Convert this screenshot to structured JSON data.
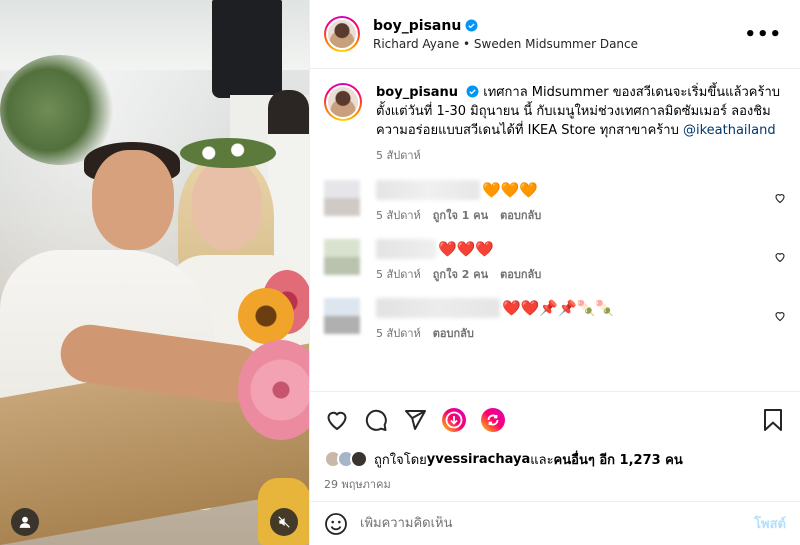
{
  "colors": {
    "link": "#00376b",
    "verified": "#0095f6",
    "muted": "#737373",
    "post_disabled": "#b2dffc"
  },
  "header": {
    "username": "boy_pisanu",
    "subline": "Richard Ayane • Sweden Midsummer Dance",
    "more_label": "•••"
  },
  "caption": {
    "username": "boy_pisanu",
    "text": " เทศกาล Midsummer ของสวีเดนจะเริ่มขึ้นแล้วคร้าบ ตั้งแต่วันที่ 1-30 มิถุนายน นี้ กับเมนูใหม่ช่วงเทศกาลมิดซัมเมอร์ ลองชิมความอร่อยแบบสวีเดนได้ที่ IKEA Store ทุกสาขาคร้าบ ",
    "mention": "@ikeathailand",
    "time": "5 สัปดาห์"
  },
  "comments": [
    {
      "emojis": "🧡🧡🧡",
      "time": "5 สัปดาห์",
      "likes": "ถูกใจ 1 คน",
      "reply": "ตอบกลับ"
    },
    {
      "emojis": "❤️❤️❤️",
      "time": "5 สัปดาห์",
      "likes": "ถูกใจ 2 คน",
      "reply": "ตอบกลับ"
    },
    {
      "emojis": "❤️❤️📌📌🍡🍡",
      "time": "5 สัปดาห์",
      "likes": "",
      "reply": "ตอบกลับ"
    }
  ],
  "likes": {
    "prefix": "ถูกใจโดย ",
    "user": "yvessirachaya",
    "middle": " และ",
    "others": "คนอื่นๆ อีก 1,273 คน"
  },
  "date": "29 พฤษภาคม",
  "add_comment": {
    "placeholder": "เพิ่มความคิดเห็น",
    "post_label": "โพสต์"
  }
}
